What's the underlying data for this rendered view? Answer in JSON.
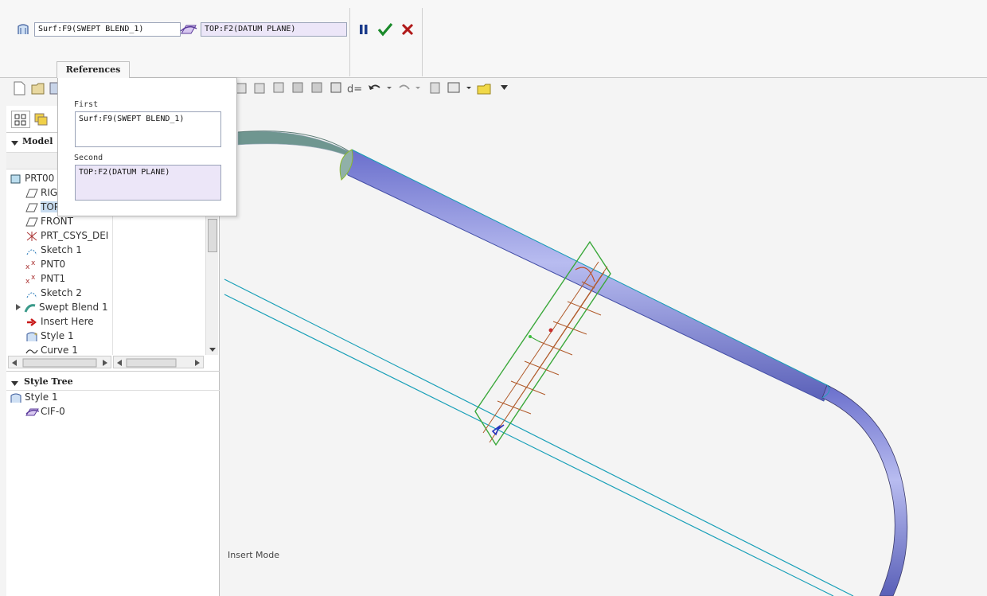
{
  "dashboard": {
    "first_reference": "Surf:F9(SWEPT BLEND_1)",
    "second_reference": "TOP:F2(DATUM PLANE)",
    "tab_references": "References"
  },
  "references_popup": {
    "first_label": "First",
    "first_value": "Surf:F9(SWEPT BLEND_1)",
    "second_label": "Second",
    "second_value": "TOP:F2(DATUM PLANE)"
  },
  "model_tree": {
    "header": "Model",
    "items": [
      {
        "label": "PRT00"
      },
      {
        "label": "RIG"
      },
      {
        "label": "TOP"
      },
      {
        "label": "FRONT"
      },
      {
        "label": "PRT_CSYS_DEI"
      },
      {
        "label": "Sketch 1"
      },
      {
        "label": "PNT0"
      },
      {
        "label": "PNT1"
      },
      {
        "label": "Sketch 2"
      },
      {
        "label": "Swept Blend 1"
      },
      {
        "label": "Insert Here"
      },
      {
        "label": "Style 1"
      },
      {
        "label": "Curve 1"
      }
    ]
  },
  "style_tree": {
    "header": "Style Tree",
    "items": [
      {
        "label": "Style 1"
      },
      {
        "label": "CIF-0"
      }
    ]
  },
  "status": {
    "mode": "Insert Mode"
  },
  "colors": {
    "accent_green": "#1a8a2a",
    "cancel_red": "#b01818",
    "pause_blue": "#1a3a8a",
    "surface": "#8a8fd8",
    "datum": "#1aa0b8",
    "plane_green": "#3aa83a",
    "curve_brown": "#b05a2a"
  }
}
